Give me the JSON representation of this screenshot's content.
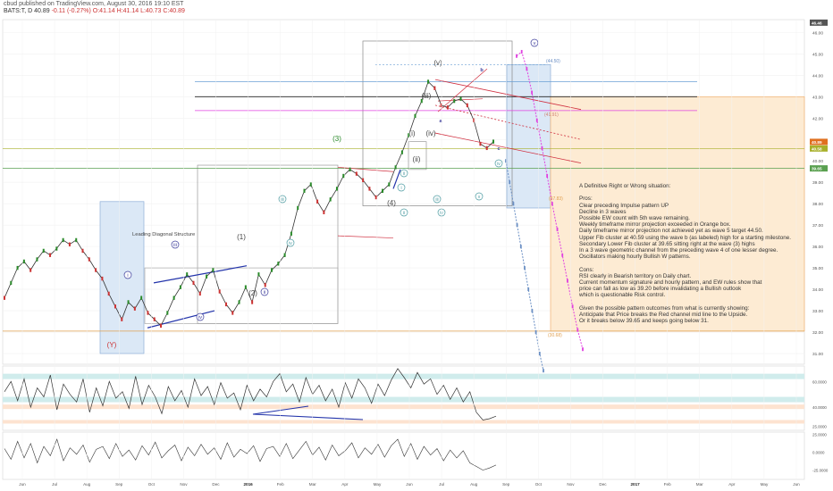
{
  "header": {
    "publisher_line": "cbud published on TradingView.com, August 30, 2016 19:10 EST",
    "symbol": "BATS:T",
    "change": "D 40.89",
    "change_val": "-0.11 (-0.27%)",
    "ohlc": "O:41.14 H:41.14 L:40.73 C:40.89"
  },
  "colors": {
    "price_line": "#333333",
    "up": "#2a8a2a",
    "down": "#cc3333",
    "box_blue": "#dbe8f6",
    "box_orange": "#fdebd3",
    "magenta": "#e040e0",
    "channel_red": "#d03040",
    "trend_blue": "#2233aa",
    "wave_label": "#3a3a9a"
  },
  "chart_data": [
    {
      "type": "line",
      "title": "",
      "ylabel": "",
      "xlabel": "",
      "ylim": [
        30.5,
        46.6
      ],
      "y_ticks": [
        31,
        32,
        33,
        34,
        35,
        36,
        37,
        38,
        39,
        40,
        41,
        42,
        43,
        44,
        45,
        46
      ],
      "y_tick_labels": [
        "31.00",
        "32.00",
        "33.00",
        "34.00",
        "35.00",
        "36.00",
        "37.00",
        "38.00",
        "39.00",
        "40.00",
        "41.00",
        "42.00",
        "43.00",
        "44.00",
        "45.00",
        "46.00"
      ],
      "x_ticks": [
        "Jun",
        "Jul",
        "Aug",
        "Sep",
        "Oct",
        "Nov",
        "Dec",
        "2016",
        "Feb",
        "Mar",
        "Apr",
        "May",
        "Jun",
        "Jul",
        "Aug",
        "Sep",
        "Oct",
        "Nov",
        "Dec",
        "2017",
        "Feb",
        "Mar",
        "Apr",
        "May",
        "Jun"
      ],
      "price_badges": [
        {
          "value": 46.46,
          "label": "46.46",
          "color": "#555555"
        },
        {
          "value": 40.89,
          "label": "40.89",
          "color": "#e07020"
        },
        {
          "value": 40.58,
          "label": "40.58",
          "color": "#a8b02a"
        },
        {
          "value": 39.65,
          "label": "39.65",
          "color": "#5aa050"
        }
      ],
      "horizontal_levels": [
        {
          "value": 43.7,
          "color": "#6a9fd4"
        },
        {
          "value": 43.0,
          "color": "#222222"
        },
        {
          "value": 42.35,
          "color": "#e040e0"
        },
        {
          "value": 40.58,
          "color": "#a8b02a"
        },
        {
          "value": 39.65,
          "color": "#5aa050"
        },
        {
          "value": 32.05,
          "color": "#e0a050"
        }
      ],
      "series": [
        {
          "values": [
            33.6,
            34.3,
            35.0,
            35.3,
            34.9,
            35.4,
            35.8,
            35.6,
            35.9,
            36.3,
            36.1,
            36.3,
            35.8,
            35.4,
            34.9,
            34.5,
            33.8,
            33.2,
            32.6,
            33.4,
            33.1,
            33.6,
            32.9,
            32.6,
            32.3,
            32.9,
            33.6,
            34.1,
            34.7,
            34.3,
            33.8,
            34.6,
            34.9,
            33.9,
            33.3,
            32.9,
            33.4,
            34.1,
            33.4,
            34.7,
            34.2,
            34.9,
            35.2,
            35.6,
            36.6,
            37.8,
            38.6,
            38.9,
            38.1,
            37.6,
            38.2,
            38.7,
            39.3,
            39.6,
            39.4,
            39.1,
            38.7,
            38.3,
            38.6,
            38.9,
            39.7,
            40.4,
            41.2,
            42.1,
            42.8,
            43.7,
            43.4,
            42.6,
            42.5,
            42.8,
            42.9,
            42.6,
            41.9,
            40.8,
            40.6,
            40.9
          ]
        }
      ],
      "projections": [
        {
          "name": "",
          "color": "#e040e0",
          "values": [
            44.9,
            45.1,
            44.3,
            43.2,
            41.9,
            40.6,
            39.3,
            38.0,
            36.8,
            35.6,
            34.4,
            33.2,
            32.1,
            31.2
          ]
        },
        {
          "name": "",
          "color": "#6a8fc4",
          "values": [
            40.0,
            39.0,
            38.0,
            37.0,
            36.0,
            35.0,
            34.0,
            33.0,
            32.0,
            31.0,
            30.2
          ]
        }
      ],
      "labels": [
        {
          "text": "(Y)",
          "color": "#cc3333"
        },
        {
          "text": "(1)"
        },
        {
          "text": "(2)"
        },
        {
          "text": "(3)",
          "color": "#2a8a2a"
        },
        {
          "text": "(4)"
        },
        {
          "text": "(i)"
        },
        {
          "text": "(ii)"
        },
        {
          "text": "(iii)"
        },
        {
          "text": "(iv)"
        },
        {
          "text": "(v)"
        },
        {
          "text": "i"
        },
        {
          "text": "ii"
        },
        {
          "text": "iii"
        },
        {
          "text": "iv"
        },
        {
          "text": "v"
        },
        {
          "text": "a"
        },
        {
          "text": "b"
        },
        {
          "text": "c"
        }
      ],
      "text_annotations": [
        {
          "text": "Leading Diagonal Structure"
        },
        {
          "text": "(44.50)"
        },
        {
          "text": "(41.91)"
        },
        {
          "text": "(37.83)"
        },
        {
          "text": "(30.68)"
        }
      ]
    },
    {
      "type": "line",
      "title": "",
      "ylim": [
        22,
        72
      ],
      "y_ticks": [
        25,
        40,
        60
      ],
      "y_tick_labels": [
        "25.0000",
        "40.0000",
        "60.0000"
      ],
      "series": [
        {
          "values": [
            52,
            60,
            45,
            62,
            40,
            55,
            48,
            65,
            38,
            58,
            50,
            44,
            62,
            36,
            55,
            41,
            60,
            47,
            52,
            39,
            64,
            42,
            57,
            48,
            35,
            56,
            45,
            53,
            40,
            62,
            49,
            56,
            42,
            59,
            47,
            51,
            38,
            57,
            45,
            54,
            48,
            60,
            66,
            52,
            58,
            44,
            63,
            50,
            57,
            45,
            54,
            40,
            59,
            47,
            62,
            55,
            43,
            58,
            49,
            61,
            70,
            63,
            55,
            67,
            58,
            62,
            50,
            57,
            46,
            55,
            44,
            52,
            36,
            30,
            31,
            33
          ]
        }
      ]
    },
    {
      "type": "line",
      "title": "",
      "ylim": [
        -38,
        28
      ],
      "y_ticks": [
        25,
        0,
        -25
      ],
      "y_tick_labels": [
        "25.0000",
        "0.0000",
        "-25.0000"
      ],
      "series": [
        {
          "values": [
            5,
            -10,
            15,
            -8,
            12,
            -15,
            8,
            -5,
            18,
            -12,
            6,
            -3,
            10,
            -14,
            4,
            8,
            -9,
            12,
            -6,
            3,
            -11,
            9,
            -4,
            14,
            -8,
            2,
            10,
            -12,
            7,
            -5,
            11,
            -3,
            6,
            -10,
            13,
            -7,
            4,
            -2,
            9,
            -13,
            5,
            8,
            -6,
            12,
            -9,
            3,
            15,
            -4,
            7,
            -11,
            10,
            -5,
            2,
            13,
            -8,
            6,
            -3,
            11,
            -7,
            9,
            18,
            -6,
            12,
            -10,
            8,
            -4,
            5,
            -12,
            3,
            -8,
            2,
            -15,
            -20,
            -25,
            -22,
            -18
          ]
        }
      ]
    }
  ],
  "notes": {
    "lines": [
      "A Definitive Right or Wrong situation:",
      "",
      "Pros:",
      "Clear preceding Impulse pattern UP",
      "Decline in 3 waves",
      "Possible EW count with 5th wave remaining.",
      "Weekly timeframe mirror projection exceeded in Orange box.",
      "Daily timeframe mirror projection not achieved yet as wave 5 target 44.50.",
      "Upper Fib cluster at 40.59 using the wave b (as labeled) high for a starting milestone.",
      "Secondary Lower Fib cluster at 39.65 sitting right at the wave (3) highs",
      "In a 3 wave geometric channel from the preceding wave 4 of one lesser degree.",
      "Oscillators making hourly Bullish W patterns.",
      "",
      "Cons:",
      "RSI clearly in Bearish territory on Daily chart.",
      "Current momentum signature and hourly pattern, and EW rules show that",
      "price can fall as low as 39.20 before invalidating a Bullish outlook",
      "which is questionable Risk control.",
      "",
      "Given the possible pattern outcomes from what is currently showing:",
      "Anticipate that Price breaks the Red channel mid line to the Upside.",
      "Or it breaks below 39.65 and keeps going below 31."
    ]
  }
}
